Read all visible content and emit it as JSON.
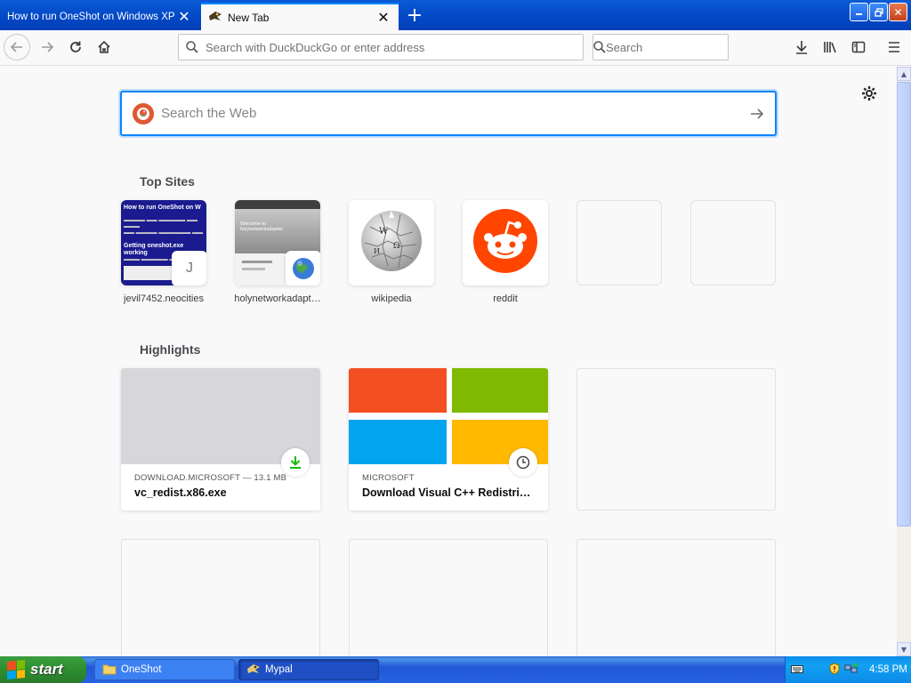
{
  "tabs": [
    {
      "title": "How to run OneShot on Windows XP",
      "active": false
    },
    {
      "title": "New Tab",
      "active": true
    }
  ],
  "navbar": {
    "url_placeholder": "Search with DuckDuckGo or enter address",
    "search_placeholder": "Search"
  },
  "newtab": {
    "web_search_placeholder": "Search the Web",
    "top_sites_title": "Top Sites",
    "highlights_title": "Highlights",
    "top_sites": [
      {
        "label": "jevil7452.neocities",
        "letter": "J"
      },
      {
        "label": "holynetworkadapt…"
      },
      {
        "label": "wikipedia"
      },
      {
        "label": "reddit"
      }
    ],
    "thumb1_text": {
      "title": "How to run OneShot on W",
      "heading": "Getting oneshot.exe working"
    },
    "thumb2_text": "Welcome to holynetworkadapter",
    "highlights": [
      {
        "source": "DOWNLOAD.MICROSOFT — 13.1 MB",
        "title": "vc_redist.x86.exe",
        "badge": "download-icon"
      },
      {
        "source": "MICROSOFT",
        "title": "Download Visual C++ Redistribu…",
        "badge": "clock-icon"
      }
    ]
  },
  "taskbar": {
    "start_label": "start",
    "tasks": [
      {
        "label": "OneShot",
        "icon": "folder-icon"
      },
      {
        "label": "Mypal",
        "icon": "mypal-icon"
      }
    ],
    "clock": "4:58 PM"
  },
  "colors": {
    "accent": "#0a84ff",
    "reddit": "#ff4500",
    "ms_red": "#f25022",
    "ms_green": "#7fba00",
    "ms_blue": "#00a4ef",
    "ms_yellow": "#ffb900"
  }
}
